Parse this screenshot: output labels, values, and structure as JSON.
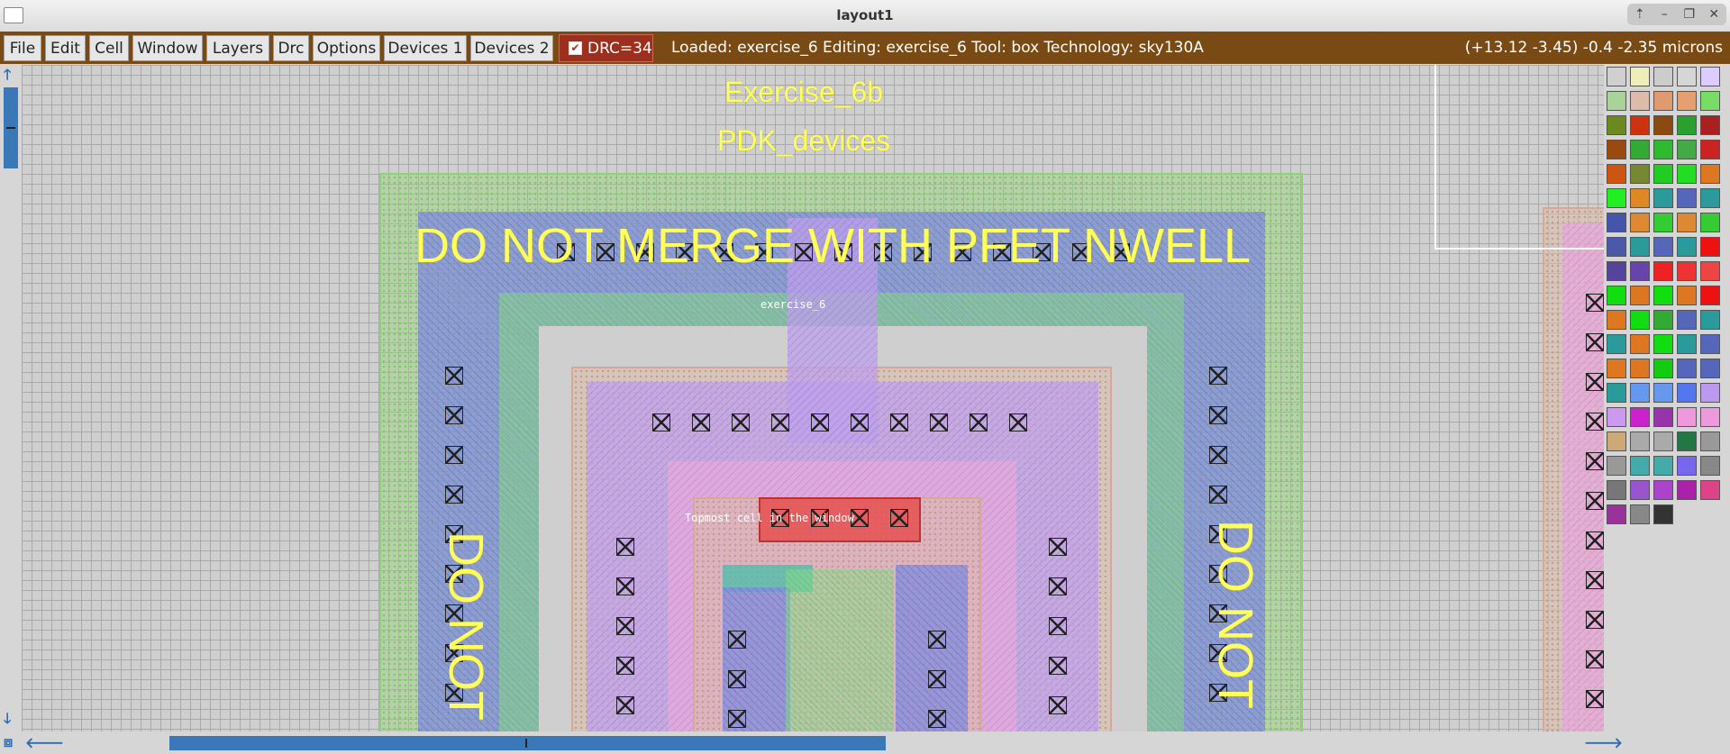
{
  "window": {
    "title": "layout1",
    "controls": [
      "up-arrow-icon",
      "minimize-icon",
      "restore-icon",
      "close-icon"
    ]
  },
  "menu": {
    "items": [
      "File",
      "Edit",
      "Cell",
      "Window",
      "Layers",
      "Drc",
      "Options",
      "Devices 1",
      "Devices 2"
    ]
  },
  "drc": {
    "label": "DRC=34",
    "checked": true
  },
  "status": {
    "text": "Loaded: exercise_6 Editing: exercise_6 Tool: box  Technology: sky130A"
  },
  "coords": {
    "text": "(+13.12 -3.45) -0.4 -2.35 microns"
  },
  "layout": {
    "title1": "Exercise_6b",
    "title2": "PDK_devices",
    "banner": "DO NOT MERGE WITH PFET NWELL",
    "vertical_label": "DO NOT",
    "cell_label": "exercise_6",
    "topmost_label": "Topmost cell in the window"
  },
  "colors": {
    "menubar": "#7a4a14",
    "drc_bg": "#9c2f1d",
    "scroll_thumb": "#3b78b7",
    "label_yellow": "#ffff55"
  }
}
